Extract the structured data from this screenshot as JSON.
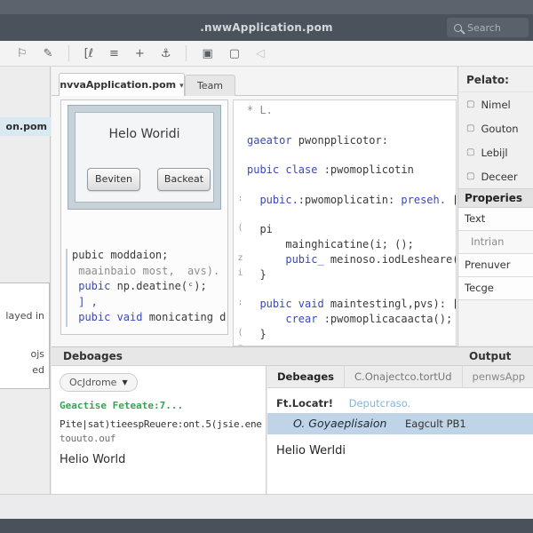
{
  "titlebar": {
    "title": ".nwwApplication.pom",
    "search_label": "Search"
  },
  "toolbar": {
    "icons": [
      {
        "name": "flag-icon",
        "glyph": "⚐"
      },
      {
        "name": "pen-icon",
        "glyph": "✎"
      },
      {
        "sep": true
      },
      {
        "name": "code-icon",
        "glyph": "[ℓ"
      },
      {
        "name": "list-icon",
        "glyph": "≡"
      },
      {
        "name": "add-icon",
        "glyph": "+"
      },
      {
        "name": "anchor-icon",
        "glyph": "⚓"
      },
      {
        "sep": true
      },
      {
        "name": "frame-icon",
        "glyph": "▣"
      },
      {
        "name": "document-icon",
        "glyph": "▢"
      },
      {
        "name": "mute-icon",
        "glyph": "◁",
        "faded": true
      }
    ]
  },
  "rail": {
    "selected": "on.pom",
    "fragments": [
      "layed in",
      "ojs",
      "ed"
    ]
  },
  "tabs": {
    "active": "nvvaApplication.pom",
    "caret": "▾",
    "secondary": "Team"
  },
  "designer": {
    "frame_title": "Helo Woridi",
    "button1": "Beviten",
    "button2": "Backeat",
    "code_lines": [
      {
        "s": [
          [
            "pubic moddaion;",
            "tx"
          ]
        ]
      },
      {
        "s": [
          [
            " maainbaio most,  avs).",
            "mut ovl"
          ]
        ]
      },
      {
        "s": [
          [
            " pubic ",
            "kw"
          ],
          [
            "np.deatine(ᶜ);",
            "tx"
          ]
        ]
      },
      {
        "s": [
          [
            " ] ,",
            "kw"
          ]
        ]
      },
      {
        "s": [
          [
            " pubic vaid ",
            "kw"
          ],
          [
            "monicating d",
            "tx"
          ]
        ]
      }
    ]
  },
  "editor": {
    "lines": [
      {
        "s": [
          [
            "* L.",
            "mut"
          ]
        ]
      },
      {},
      {
        "s": [
          [
            "gaeator ",
            "kw"
          ],
          [
            "pwonpplicotor:",
            "tx"
          ]
        ]
      },
      {},
      {
        "s": [
          [
            "pubic clase ",
            "kw"
          ],
          [
            ":pwomoplicotin",
            "tx"
          ]
        ]
      },
      {},
      {
        "g": ":",
        "s": [
          [
            "  pubic.",
            "kw"
          ],
          [
            ":pwomoplicatin: ",
            "tx"
          ],
          [
            "preseh. ",
            "kw"
          ],
          [
            "[",
            "tx"
          ]
        ]
      },
      {},
      {
        "g": "(",
        "s": [
          [
            "  pi",
            "tx"
          ]
        ]
      },
      {
        "s": [
          [
            "      mainghicatine(i; ();",
            "tx"
          ]
        ]
      },
      {
        "g": "z",
        "s": [
          [
            "      pubic_ ",
            "kw"
          ],
          [
            "meinoso.iodLesheare(:",
            "tx"
          ]
        ]
      },
      {
        "g": "i",
        "s": [
          [
            "  }",
            "tx"
          ]
        ]
      },
      {},
      {
        "g": ":",
        "s": [
          [
            "  pubic vaid ",
            "kw"
          ],
          [
            "maintestingl,pvs): [",
            "tx"
          ]
        ]
      },
      {
        "s": [
          [
            "      crear ",
            "kw"
          ],
          [
            ":pwomoplicacaacta();",
            "tx"
          ]
        ]
      },
      {
        "g": "(",
        "s": [
          [
            "  }",
            "tx"
          ]
        ]
      },
      {
        "g": "z"
      }
    ]
  },
  "palette": {
    "header": "Pelato:",
    "item_icon": "▢",
    "items": [
      "Nimel",
      "Gouton",
      "Lebijl",
      "Deceer"
    ]
  },
  "properties": {
    "header": "Properies",
    "rows": [
      {
        "label": "Text"
      },
      {
        "label": "Intrian",
        "muted": true
      },
      {
        "label": "Prenuver"
      },
      {
        "label": "Tecge"
      }
    ]
  },
  "bottom": {
    "left_header": "Deboages",
    "right_header": "Output"
  },
  "console": {
    "dropdown_label": "OcJdrome",
    "dropdown_caret": "▼",
    "lines": [
      {
        "t": "Geactise Feteate:7...",
        "c": "grn"
      },
      {
        "t": "Pite|sat)tieespReuere:ont.5(jsie.ene",
        "c": ""
      },
      {
        "t": "touuto.ouf",
        "c": "mut2"
      },
      {
        "t": "Helio World",
        "c": "big"
      }
    ]
  },
  "output_panel": {
    "tabs": [
      {
        "label": "Debeages",
        "active": true
      },
      {
        "label": "C.Onajectco.tortUd"
      },
      {
        "label": "penwsApp",
        "last": true
      }
    ],
    "locator_label": "Ft.Locatr!",
    "locator_value": "Deputcraso.",
    "selected_row": {
      "name": "O. Goyaeplisaion",
      "value": "Eagcult PB1"
    },
    "result_line": "Helio Werldi"
  },
  "colors": {
    "titlebar": "#4a535c",
    "keyword_blue": "#3a49b8",
    "console_green": "#3d9e55",
    "selection_blue": "#bfd4e6",
    "rail_selection": "#d8e9f2"
  }
}
